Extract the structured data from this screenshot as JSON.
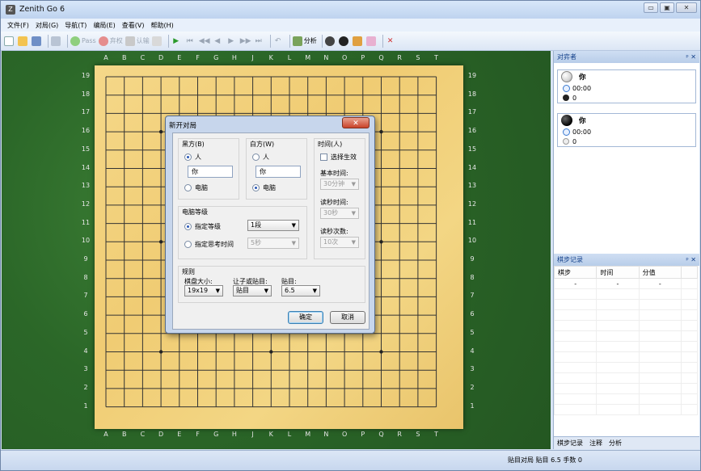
{
  "app": {
    "title": "Zenith Go 6",
    "window_buttons": [
      "▭",
      "▣",
      "✕"
    ]
  },
  "menu": [
    "文件(F)",
    "对局(G)",
    "导航(T)",
    "编局(E)",
    "查看(V)",
    "帮助(H)"
  ],
  "toolbar": {
    "pass": "Pass",
    "resign": "弃权",
    "concede": "认输",
    "analyze": "分析"
  },
  "board": {
    "columns": [
      "A",
      "B",
      "C",
      "D",
      "E",
      "F",
      "G",
      "H",
      "J",
      "K",
      "L",
      "M",
      "N",
      "O",
      "P",
      "Q",
      "R",
      "S",
      "T"
    ],
    "rows": [
      "19",
      "18",
      "17",
      "16",
      "15",
      "14",
      "13",
      "12",
      "11",
      "10",
      "9",
      "8",
      "7",
      "6",
      "5",
      "4",
      "3",
      "2",
      "1"
    ]
  },
  "players_panel": {
    "title": "对弈者",
    "close": "✕",
    "pin": "ᵖ",
    "white": {
      "name": "你",
      "time": "00:00",
      "captures": "0"
    },
    "black": {
      "name": "你",
      "time": "00:00",
      "captures": "0"
    }
  },
  "move_log": {
    "title": "棋步记录",
    "columns": [
      "棋步",
      "时间",
      "分值"
    ],
    "rows": [
      [
        "-",
        "-",
        "-"
      ]
    ]
  },
  "panel_tabs": [
    "棋步记录",
    "注释",
    "分析"
  ],
  "status": {
    "text": "贴目对局 贴目 6.5 手数 0"
  },
  "dialog": {
    "title": "新开对局",
    "close": "✕",
    "black": {
      "label": "黑方(B)",
      "human": "人",
      "name": "你",
      "computer": "电脑"
    },
    "white": {
      "label": "白方(W)",
      "human": "人",
      "name": "你",
      "computer": "电脑"
    },
    "time": {
      "label": "时间(人)",
      "enable": "选择生效",
      "main_label": "基本时间:",
      "main_value": "30分钟",
      "byo_label": "读秒时间:",
      "byo_value": "30秒",
      "periods_label": "读秒次数:",
      "periods_value": "10次"
    },
    "ai": {
      "label": "电脑等级",
      "level_option": "指定等级",
      "level_value": "1段",
      "think_option": "指定思考时间",
      "think_value": "5秒"
    },
    "rules": {
      "label": "规则",
      "size_label": "棋盘大小:",
      "size_value": "19x19",
      "handicap_label": "让子或贴目:",
      "handicap_value": "贴目",
      "komi_label": "贴目:",
      "komi_value": "6.5"
    },
    "ok": "确定",
    "cancel": "取消"
  }
}
